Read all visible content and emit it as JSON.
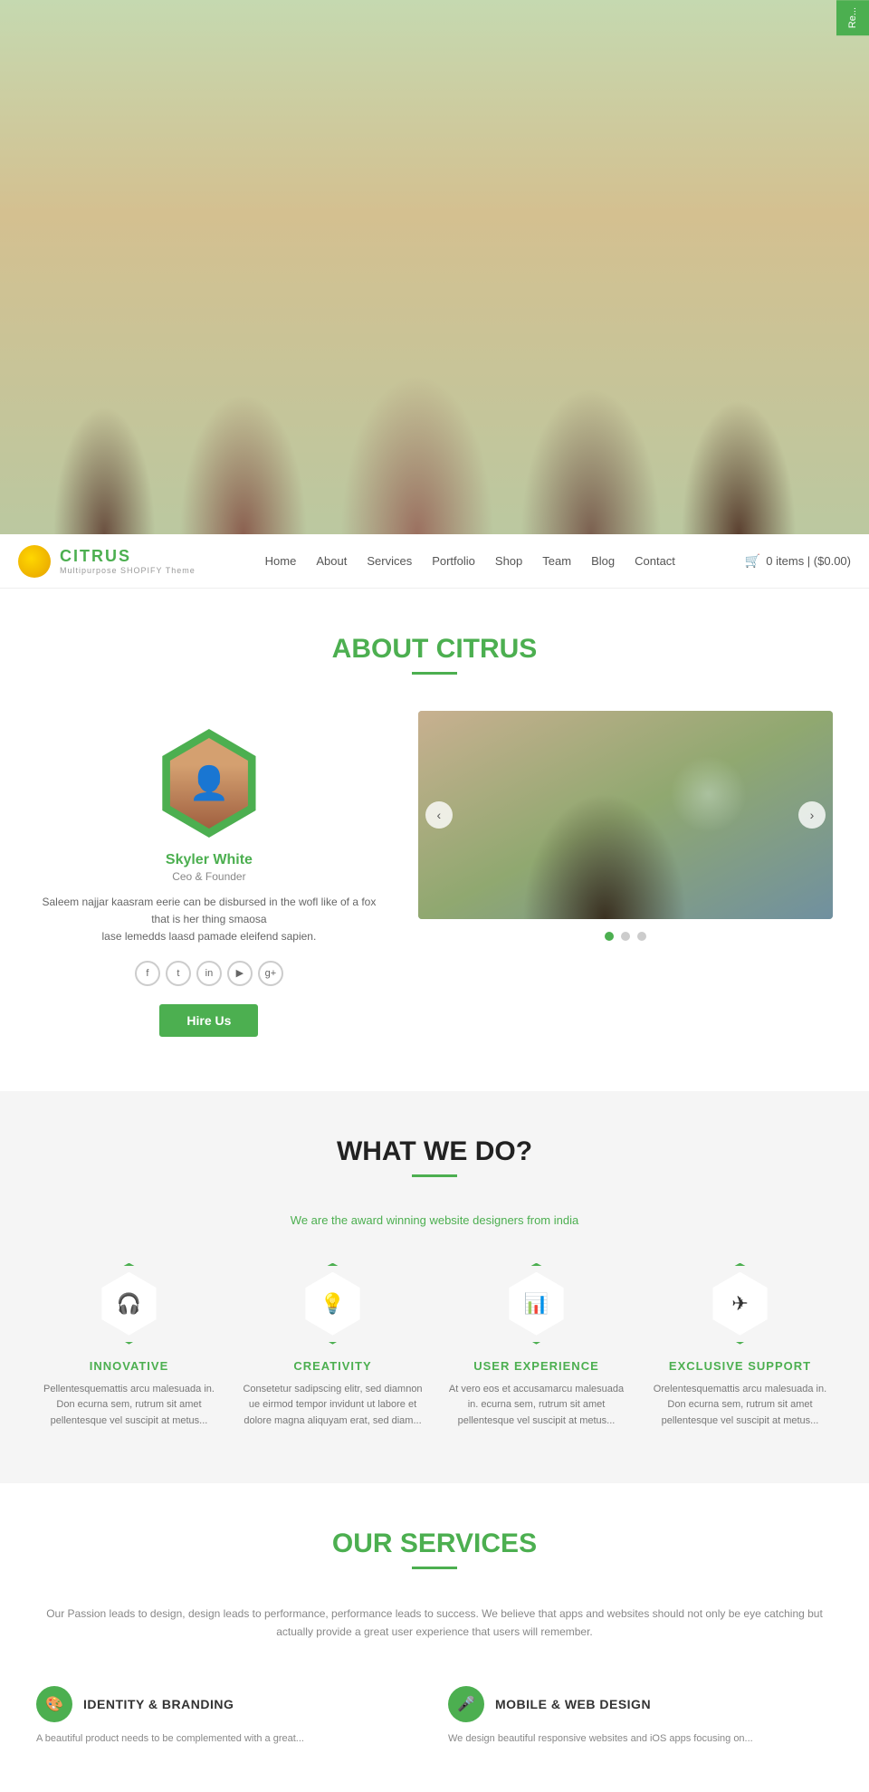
{
  "register": {
    "label": "Re..."
  },
  "navbar": {
    "logo_name": "CIT",
    "logo_name_highlight": "RUS",
    "logo_sub": "Multipurpose SHOPIFY Theme",
    "links": [
      {
        "label": "Home",
        "href": "#"
      },
      {
        "label": "About",
        "href": "#"
      },
      {
        "label": "Services",
        "href": "#"
      },
      {
        "label": "Portfolio",
        "href": "#"
      },
      {
        "label": "Shop",
        "href": "#"
      },
      {
        "label": "Team",
        "href": "#"
      },
      {
        "label": "Blog",
        "href": "#"
      },
      {
        "label": "Contact",
        "href": "#"
      }
    ],
    "cart_text": "0 items | ($0.00)"
  },
  "about": {
    "heading": "ABOUT ",
    "heading_highlight": "CITRUS",
    "person": {
      "name": "Skyler White",
      "title": "Ceo & Founder",
      "desc_line1": "Saleem najjar kaasram eerie can be disbursed in the wofl like of a fox that is her thing smaosa",
      "desc_line2": "lase lemedds laasd pamade eleifend sapien.",
      "hire_label": "Hire Us"
    },
    "social_icons": [
      "f",
      "t",
      "in",
      "yt",
      "g+"
    ],
    "slider_dots": [
      true,
      false,
      false
    ]
  },
  "whatwedo": {
    "heading": "WHAT WE DO?",
    "subtitle": "We are the award winning website designers from india",
    "features": [
      {
        "icon": "🎧",
        "title": "INNOVATIVE",
        "desc": "Pellentesquemattis arcu malesuada in. Don ecurna sem, rutrum sit amet pellentesque vel suscipit at metus..."
      },
      {
        "icon": "💡",
        "title": "CREATIVITY",
        "desc": "Consetetur sadipscing elitr, sed diamnon ue eirmod tempor invidunt ut labore et dolore magna aliquyam erat, sed diam..."
      },
      {
        "icon": "📊",
        "title": "USER EXPERIENCE",
        "desc": "At vero eos et accusamarcu malesuada in. ecurna sem, rutrum sit amet pellentesque vel suscipit at metus..."
      },
      {
        "icon": "✈",
        "title": "EXCLUSIVE SUPPORT",
        "desc": "Orelentesquemattis arcu malesuada in. Don ecurna sem, rutrum sit amet pellentesque vel suscipit at metus..."
      }
    ]
  },
  "services": {
    "heading": "OUR ",
    "heading_highlight": "SERVICES",
    "subtitle": "Our Passion leads to design, design leads to performance, performance leads to success. We believe that apps and websites should not only be eye catching but actually provide a great user experience that users will remember.",
    "items": [
      {
        "icon": "🎨",
        "name": "IDENTITY & BRANDING",
        "desc": "A beautiful product needs to be complemented with a great..."
      },
      {
        "icon": "🎤",
        "name": "MOBILE & WEB DESIGN",
        "desc": "We design beautiful responsive websites and iOS apps focusing on..."
      }
    ]
  }
}
